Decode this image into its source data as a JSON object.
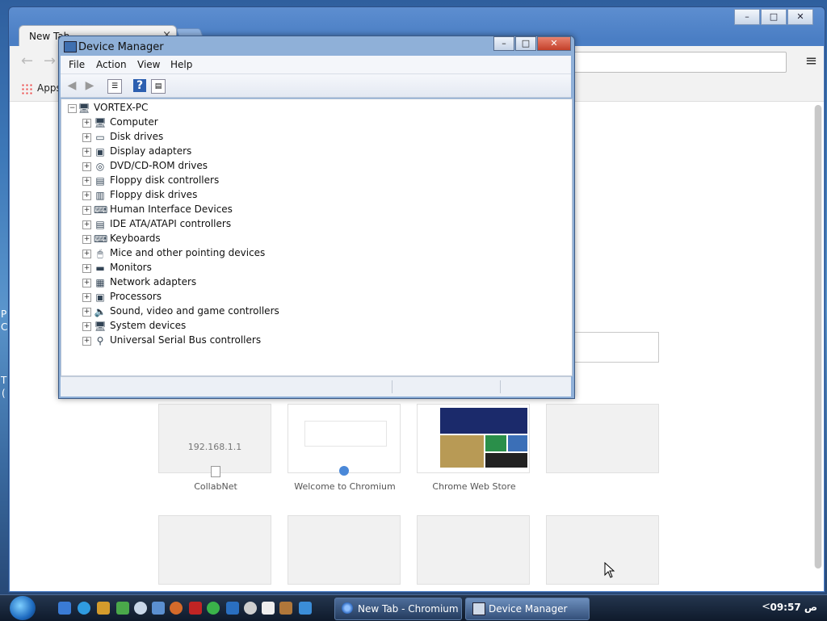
{
  "browser": {
    "tab_title": "New Tab",
    "tab_close": "×",
    "apps_label": "Apps",
    "window_controls": [
      "–",
      "□",
      "✕"
    ],
    "menu_glyph": "≡",
    "search_box_value": "",
    "tiles_row1": [
      {
        "title": "CollabNet",
        "caption": "192.168.1.1",
        "kind": "blank-page"
      },
      {
        "title": "Welcome to Chromium",
        "caption": "",
        "kind": "screenshot-welcome"
      },
      {
        "title": "Chrome Web Store",
        "caption": "",
        "kind": "screenshot-store"
      },
      {
        "title": "",
        "caption": "",
        "kind": "empty"
      }
    ],
    "tiles_row2": [
      {
        "title": ""
      },
      {
        "title": ""
      },
      {
        "title": ""
      },
      {
        "title": ""
      }
    ]
  },
  "device_manager": {
    "title": "Device Manager",
    "window_controls": [
      "–",
      "□",
      "✕"
    ],
    "menu": [
      "File",
      "Action",
      "View",
      "Help"
    ],
    "toolbar_icons": [
      "back-arrow-icon",
      "forward-arrow-icon",
      "properties-icon",
      "help-icon",
      "scan-hardware-icon"
    ],
    "root": {
      "label": "VORTEX-PC",
      "expander": "−"
    },
    "nodes": [
      {
        "label": "Computer",
        "icon": "computer-icon",
        "glyph": "🖥"
      },
      {
        "label": "Disk drives",
        "icon": "disk-drive-icon",
        "glyph": "▭"
      },
      {
        "label": "Display adapters",
        "icon": "display-adapter-icon",
        "glyph": "▣"
      },
      {
        "label": "DVD/CD-ROM drives",
        "icon": "dvd-drive-icon",
        "glyph": "◎"
      },
      {
        "label": "Floppy disk controllers",
        "icon": "floppy-controller-icon",
        "glyph": "▤"
      },
      {
        "label": "Floppy disk drives",
        "icon": "floppy-drive-icon",
        "glyph": "▥"
      },
      {
        "label": "Human Interface Devices",
        "icon": "hid-icon",
        "glyph": "⌨"
      },
      {
        "label": "IDE ATA/ATAPI controllers",
        "icon": "ide-controller-icon",
        "glyph": "▤"
      },
      {
        "label": "Keyboards",
        "icon": "keyboard-icon",
        "glyph": "⌨"
      },
      {
        "label": "Mice and other pointing devices",
        "icon": "mouse-icon",
        "glyph": "🖱"
      },
      {
        "label": "Monitors",
        "icon": "monitor-icon",
        "glyph": "▬"
      },
      {
        "label": "Network adapters",
        "icon": "network-adapter-icon",
        "glyph": "▦"
      },
      {
        "label": "Processors",
        "icon": "processor-icon",
        "glyph": "▣"
      },
      {
        "label": "Sound, video and game controllers",
        "icon": "speaker-icon",
        "glyph": "🔈"
      },
      {
        "label": "System devices",
        "icon": "system-devices-icon",
        "glyph": "🖥"
      },
      {
        "label": "Universal Serial Bus controllers",
        "icon": "usb-icon",
        "glyph": "⚲"
      }
    ],
    "expander_glyph": "+"
  },
  "taskbar": {
    "tasks": [
      {
        "label": "New Tab - Chromium",
        "icon": "chromium-icon"
      },
      {
        "label": "Device Manager",
        "icon": "device-manager-icon"
      }
    ],
    "clock": "09:57 ص",
    "tray_arrow": "<"
  },
  "colors": {
    "accent": "#3b5a86",
    "close": "#c4402a"
  }
}
